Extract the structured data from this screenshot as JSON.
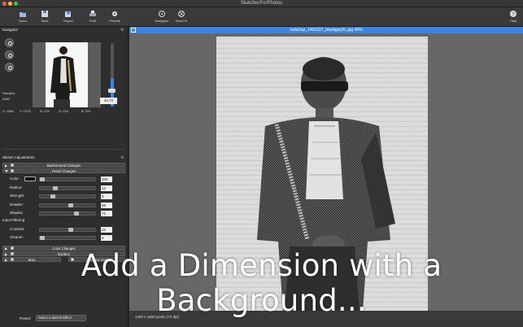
{
  "window": {
    "title": "SketcherForPhotos"
  },
  "toolbar": {
    "items": [
      {
        "label": "Open",
        "icon": "folder-open-icon"
      },
      {
        "label": "Save",
        "icon": "save-icon"
      },
      {
        "label": "Export",
        "icon": "export-icon"
      },
      {
        "label": "Print",
        "icon": "printer-icon"
      },
      {
        "label": "Presets",
        "icon": "presets-icon"
      },
      {
        "label": "Navigator",
        "icon": "navigator-icon"
      },
      {
        "label": "Best Fit",
        "icon": "best-fit-icon"
      },
      {
        "label": "Help",
        "icon": "help-icon"
      }
    ]
  },
  "navigator": {
    "title": "Navigator",
    "size_label": "Size(kb):",
    "size_value": "6480",
    "zoom_value": "44.72",
    "zoom_level": 0.45,
    "x_label": "X: 1166",
    "y_label": "Y: 1375",
    "r_label": "R: 224",
    "g_label": "G: 224",
    "b_label": "B: 224"
  },
  "sketch": {
    "title": "Sketch Adjustments",
    "groups": {
      "background": "BackGround Changes",
      "pencil": "Pencil Changes",
      "input_filtering": "Input Filtering",
      "color_changes": "Color Changes",
      "borders": "Borders",
      "brush": "Brus",
      "selective": "Selective Mas"
    },
    "pencil_rows": [
      {
        "label": "Color:",
        "value": "100",
        "level": 0.0
      },
      {
        "label": "Radius:",
        "value": "12",
        "level": 0.25
      },
      {
        "label": "Strength:",
        "value": "6",
        "level": 0.2
      },
      {
        "label": "Detailer:",
        "value": "55",
        "level": 0.55
      },
      {
        "label": "Shades:",
        "value": "71",
        "level": 0.65
      }
    ],
    "filter_rows": [
      {
        "label": "Contrast",
        "value": "23",
        "level": 0.55
      },
      {
        "label": "Cleaner:",
        "value": "0",
        "level": 0.0
      }
    ],
    "preset_label": "Preset:",
    "preset_value": "Select a Sketch Effect"
  },
  "image_window": {
    "title": "reduDsp_1461027_blackguyXL.jpg 45%",
    "dimensions": "1200 x 1800 pixels (72 dpi)"
  },
  "caption": "Add a Dimension with a Background..."
}
